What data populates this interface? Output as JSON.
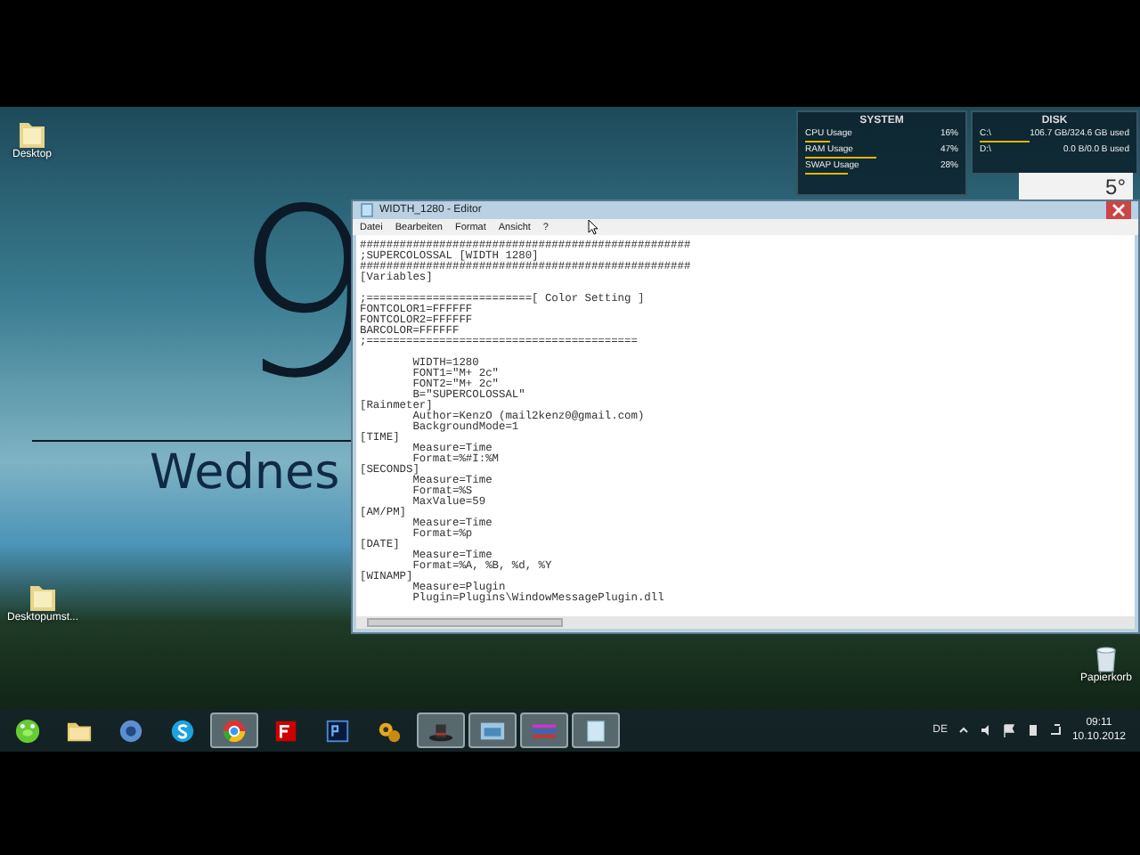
{
  "desktop_icons": [
    {
      "label": "Desktop"
    },
    {
      "label": "Desktopumst..."
    }
  ],
  "clock_skin": {
    "hour": "9",
    "weekday": "Wednes"
  },
  "system_widget": {
    "title": "SYSTEM",
    "rows": [
      {
        "label": "CPU Usage",
        "value": "16%",
        "level": 0.16
      },
      {
        "label": "RAM Usage",
        "value": "47%",
        "level": 0.47
      },
      {
        "label": "SWAP Usage",
        "value": "28%",
        "level": 0.28
      }
    ]
  },
  "disk_widget": {
    "title": "DISK",
    "rows": [
      {
        "label": "C:\\",
        "value": "106.7 GB/324.6 GB used",
        "level": 0.33
      },
      {
        "label": "D:\\",
        "value": "0.0 B/0.0 B used"
      }
    ]
  },
  "weather_widget": {
    "temperature": "5°"
  },
  "editor": {
    "title": "WIDTH_1280 - Editor",
    "menu": [
      "Datei",
      "Bearbeiten",
      "Format",
      "Ansicht",
      "?"
    ],
    "blocks": [
      [
        "##################################################",
        ";SUPERCOLOSSAL [WIDTH 1280]",
        "##################################################",
        "[Variables]"
      ],
      [
        ";=========================[ Color Setting ]",
        "FONTCOLOR1=FFFFFF",
        "FONTCOLOR2=FFFFFF",
        "BARCOLOR=FFFFFF",
        ";========================================="
      ],
      [
        "\tWIDTH=1280",
        "\tFONT1=\"M+ 2c\"",
        "\tFONT2=\"M+ 2c\"",
        "\tB=\"SUPERCOLOSSAL\"",
        "[Rainmeter]",
        "\tAuthor=KenzO (mail2kenz0@gmail.com)",
        "\tBackgroundMode=1",
        "[TIME]",
        "\tMeasure=Time",
        "\tFormat=%#I:%M",
        "[SECONDS]",
        "\tMeasure=Time",
        "\tFormat=%S",
        "\tMaxValue=59",
        "[AM/PM]",
        "\tMeasure=Time",
        "\tFormat=%p",
        "[DATE]",
        "\tMeasure=Time",
        "\tFormat=%A, %B, %d, %Y",
        "[WINAMP]",
        "\tMeasure=Plugin",
        "\tPlugin=Plugins\\WindowMessagePlugin.dll"
      ]
    ]
  },
  "recycle_bin": {
    "label": "Papierkorb"
  },
  "taskbar": {
    "apps": [
      {
        "kind": "start",
        "running": false
      },
      {
        "kind": "folder",
        "running": false
      },
      {
        "kind": "disc",
        "running": false
      },
      {
        "kind": "chat",
        "running": false
      },
      {
        "kind": "browser",
        "running": true
      },
      {
        "kind": "ftp",
        "running": false
      },
      {
        "kind": "ps",
        "running": false
      },
      {
        "kind": "gears",
        "running": false
      },
      {
        "kind": "hat",
        "running": true
      },
      {
        "kind": "explorer",
        "running": true
      },
      {
        "kind": "stripes",
        "running": true
      },
      {
        "kind": "notepad",
        "running": true
      }
    ],
    "language": "DE",
    "time": "09:11",
    "date": "10.10.2012"
  }
}
